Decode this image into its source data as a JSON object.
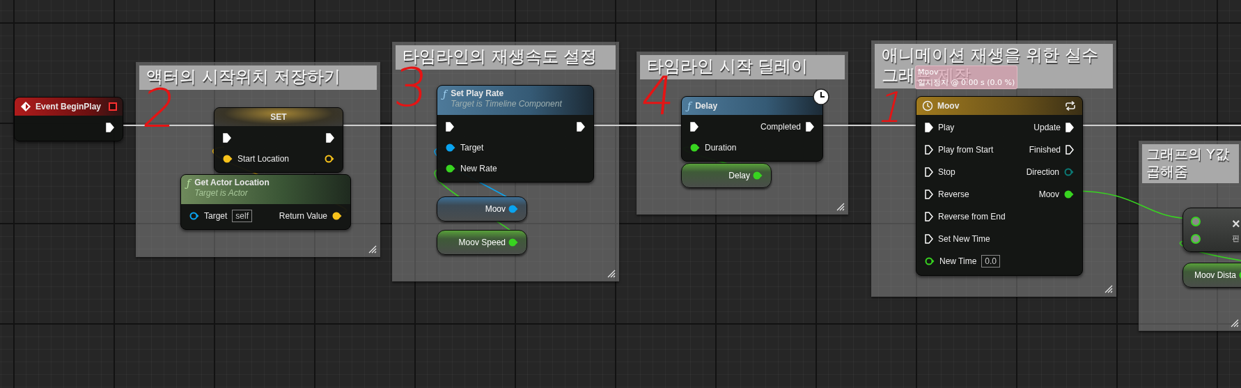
{
  "comments": [
    {
      "title": "액터의 시작위치 저장하기"
    },
    {
      "title": "타임라인의 재생속도 설정"
    },
    {
      "title": "타임라인 시작 딜레이"
    },
    {
      "title": "애니메이션 재생을 위한 실수 그래프 제작"
    },
    {
      "title": "그래프의 Y값 곱해줌"
    }
  ],
  "nodes": [
    {
      "kind": "event",
      "title": "Event BeginPlay",
      "outputs": [
        {
          "kind": "exec",
          "connected": true
        }
      ]
    },
    {
      "kind": "set",
      "title": "SET",
      "inputs": [
        {
          "kind": "exec",
          "connected": true
        },
        {
          "kind": "vector",
          "label": "Start Location",
          "connected": true
        }
      ],
      "outputs": [
        {
          "kind": "exec",
          "connected": true
        },
        {
          "kind": "vector",
          "connected": false
        }
      ]
    },
    {
      "kind": "function",
      "icon_glyph": "ƒ",
      "title": "Get Actor Location",
      "subtitle": "Target is Actor",
      "pure": true,
      "latent": false,
      "inputs": [
        {
          "kind": "object",
          "label": "Target",
          "value": "self",
          "connected": false
        }
      ],
      "outputs": [
        {
          "kind": "vector",
          "label": "Return Value",
          "connected": true
        }
      ]
    },
    {
      "kind": "function",
      "icon_glyph": "ƒ",
      "title": "Set Play Rate",
      "subtitle": "Target is Timeline Component",
      "pure": false,
      "latent": false,
      "inputs": [
        {
          "kind": "exec",
          "connected": true
        },
        {
          "kind": "object",
          "label": "Target",
          "connected": true
        },
        {
          "kind": "float",
          "label": "New Rate",
          "connected": true
        }
      ],
      "outputs": [
        {
          "kind": "exec",
          "connected": true
        }
      ]
    },
    {
      "kind": "variable",
      "title": "Moov",
      "outputs": [
        {
          "kind": "object",
          "connected": true
        }
      ]
    },
    {
      "kind": "variable",
      "title": "Moov Speed",
      "outputs": [
        {
          "kind": "float",
          "connected": true
        }
      ]
    },
    {
      "kind": "function",
      "icon_glyph": "ƒ",
      "title": "Delay",
      "pure": false,
      "latent": true,
      "inputs": [
        {
          "kind": "exec",
          "connected": true
        },
        {
          "kind": "float",
          "label": "Duration",
          "connected": true
        }
      ],
      "outputs": [
        {
          "kind": "exec",
          "label": "Completed",
          "connected": true
        }
      ]
    },
    {
      "kind": "variable",
      "title": "Delay",
      "outputs": [
        {
          "kind": "float",
          "connected": true
        }
      ]
    },
    {
      "kind": "timeline",
      "title": "Moov",
      "looping": true,
      "inputs": [
        {
          "kind": "exec",
          "label": "Play",
          "connected": true
        },
        {
          "kind": "exec",
          "label": "Play from Start",
          "connected": false
        },
        {
          "kind": "exec",
          "label": "Stop",
          "connected": false
        },
        {
          "kind": "exec",
          "label": "Reverse",
          "connected": false
        },
        {
          "kind": "exec",
          "label": "Reverse from End",
          "connected": false
        },
        {
          "kind": "exec",
          "label": "Set New Time",
          "connected": false
        },
        {
          "kind": "float",
          "label": "New Time",
          "value": "0.0",
          "connected": false
        }
      ],
      "outputs": [
        {
          "kind": "exec",
          "label": "Update",
          "connected": true
        },
        {
          "kind": "exec",
          "label": "Finished",
          "connected": false
        },
        {
          "kind": "enum",
          "label": "Direction",
          "connected": false
        },
        {
          "kind": "float",
          "label": "Moov",
          "connected": true
        }
      ]
    },
    {
      "kind": "operator",
      "symbol": "×",
      "label": "핀",
      "inputs": [
        {
          "kind": "wildcard",
          "connected": true
        },
        {
          "kind": "wildcard",
          "connected": true
        }
      ]
    },
    {
      "kind": "variable",
      "title": "Moov Dista",
      "outputs": [
        {
          "kind": "float",
          "connected": true
        }
      ]
    }
  ],
  "tooltip": {
    "title": "Moov",
    "text": "일시정지 @ 0.00 s (0.0 %)"
  },
  "annotations": [
    "2",
    "3",
    "4",
    "1"
  ]
}
